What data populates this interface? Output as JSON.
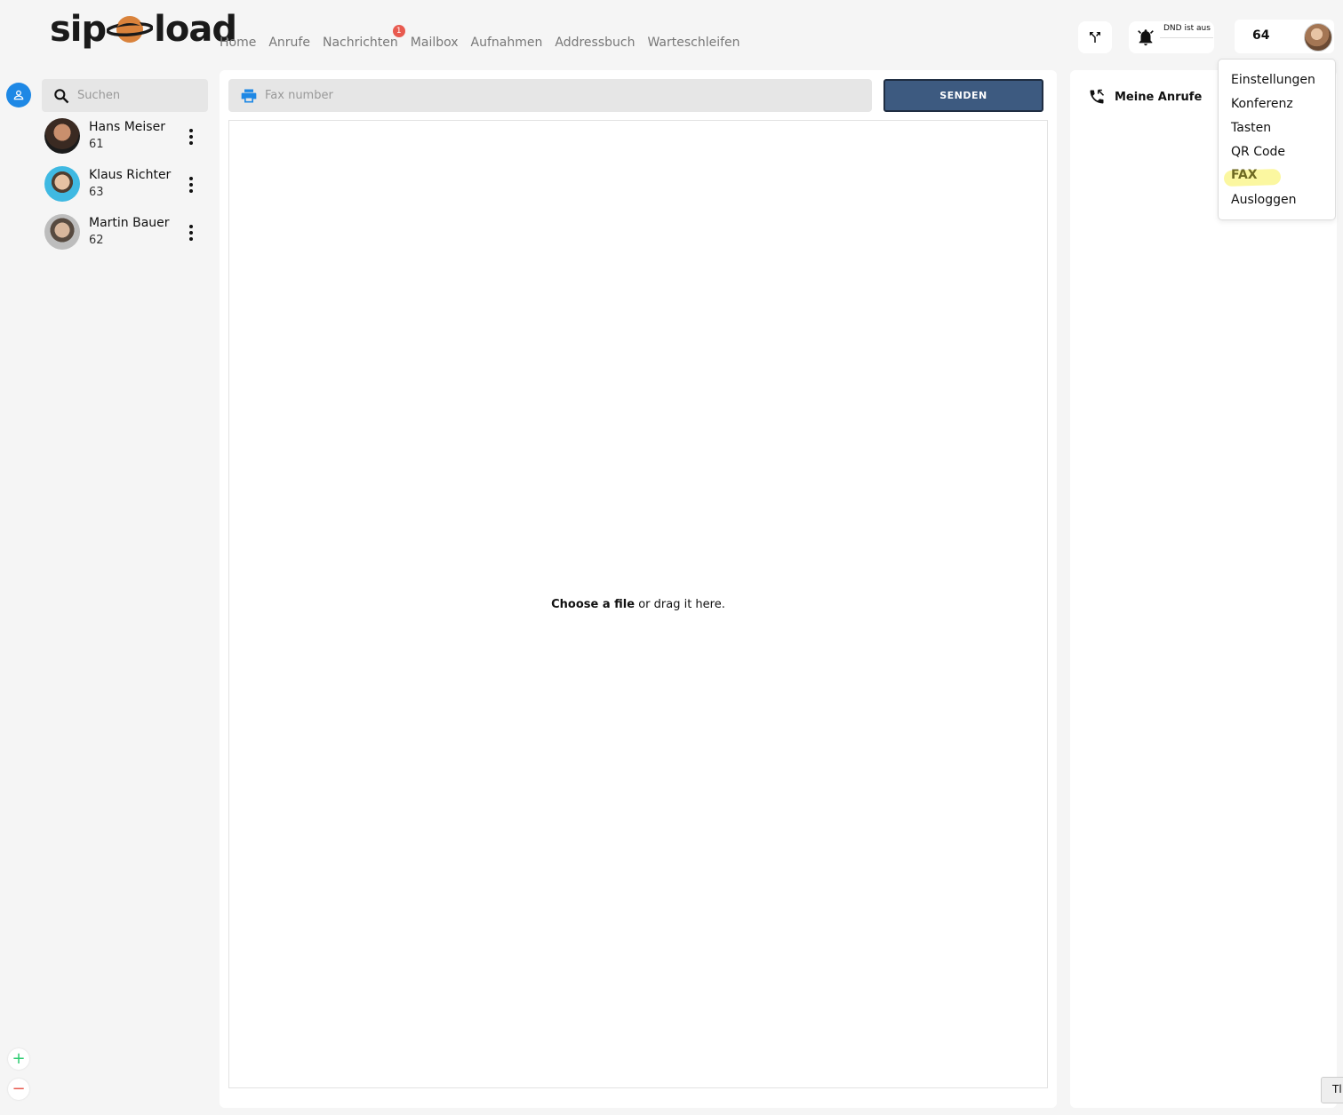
{
  "brand": {
    "logo_left": "sip",
    "logo_right": "load"
  },
  "nav": {
    "items": [
      "Home",
      "Anrufe",
      "Nachrichten",
      "Mailbox",
      "Aufnahmen",
      "Addressbuch",
      "Warteschleifen"
    ],
    "messages_badge": "1"
  },
  "header": {
    "dnd_label": "DND ist aus",
    "extension": "64"
  },
  "search": {
    "placeholder": "Suchen"
  },
  "contacts": [
    {
      "name": "Hans Meiser",
      "ext": "61"
    },
    {
      "name": "Klaus Richter",
      "ext": "63"
    },
    {
      "name": "Martin Bauer",
      "ext": "62"
    }
  ],
  "zoom": {
    "in": "+",
    "out": "−"
  },
  "fax": {
    "placeholder": "Fax number",
    "send_label": "SENDEN",
    "drop_choose": "Choose a file",
    "drop_rest": " or drag it here."
  },
  "right_panel": {
    "title": "Meine Anrufe"
  },
  "corner_label": "Tl",
  "menu": {
    "items": [
      "Einstellungen",
      "Konferenz",
      "Tasten",
      "QR Code",
      "FAX",
      "Ausloggen"
    ],
    "active": "FAX"
  },
  "colors": {
    "accent_blue": "#1e88e5",
    "send_button": "#3d5a80",
    "badge": "#e85a4f",
    "highlight": "#fbf7a0",
    "planet": "#d9823b"
  }
}
